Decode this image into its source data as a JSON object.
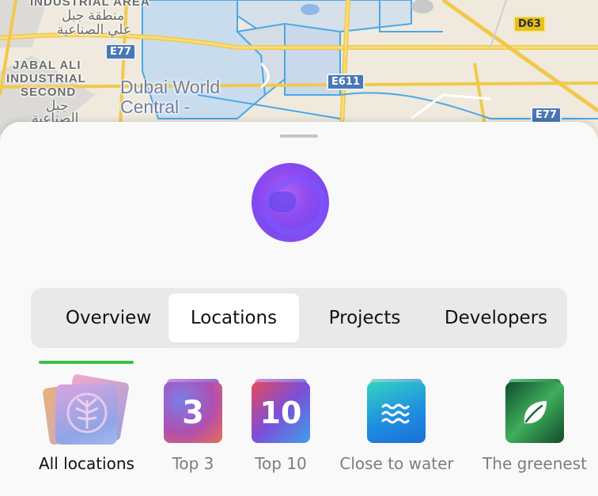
{
  "map": {
    "labels": [
      {
        "text": "INDUSTRIAL AREA"
      },
      {
        "text": "منطقة جبل"
      },
      {
        "text": "علي الصناعية"
      },
      {
        "text": "JABAL ALI"
      },
      {
        "text": "INDUSTRIAL"
      },
      {
        "text": "SECOND"
      },
      {
        "text": "جبل"
      },
      {
        "text": "الصناعية"
      }
    ],
    "city_label": "Dubai World\nCentral -",
    "shields": [
      "E77",
      "E611",
      "E77",
      "D63"
    ]
  },
  "tabs": [
    {
      "label": "Overview",
      "active": false
    },
    {
      "label": "Locations",
      "active": true
    },
    {
      "label": "Projects",
      "active": false
    },
    {
      "label": "Developers",
      "active": false
    }
  ],
  "categories": [
    {
      "label": "All locations",
      "selected": true,
      "icon": "palm-island-icon"
    },
    {
      "label": "Top 3",
      "selected": false,
      "icon": "3"
    },
    {
      "label": "Top 10",
      "selected": false,
      "icon": "10"
    },
    {
      "label": "Close to water",
      "selected": false,
      "icon": "waves-icon"
    },
    {
      "label": "The greenest",
      "selected": false,
      "icon": "leaf-icon"
    }
  ],
  "colors": {
    "accent_underline": "#3cbf48",
    "active_tab_bg": "#ffffff",
    "tab_bar_bg": "#e9e9ea"
  }
}
